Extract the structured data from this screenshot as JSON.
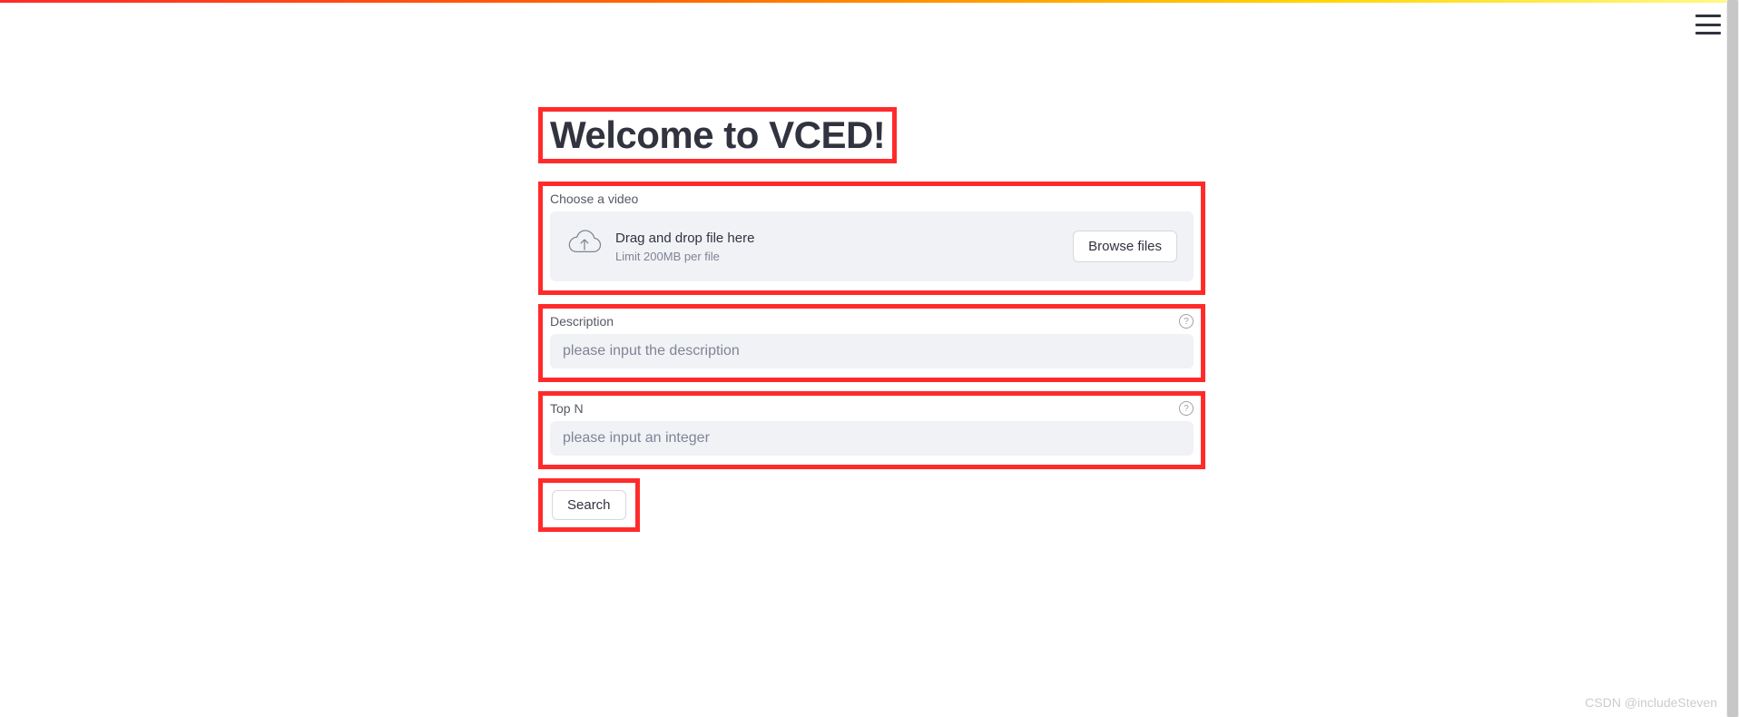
{
  "title": "Welcome to VCED!",
  "uploader": {
    "label": "Choose a video",
    "drop_text": "Drag and drop file here",
    "limit_text": "Limit 200MB per file",
    "browse_label": "Browse files"
  },
  "description": {
    "label": "Description",
    "placeholder": "please input the description",
    "help": "?"
  },
  "topn": {
    "label": "Top N",
    "placeholder": "please input an integer",
    "help": "?"
  },
  "search_label": "Search",
  "watermark": "CSDN @includeSteven"
}
